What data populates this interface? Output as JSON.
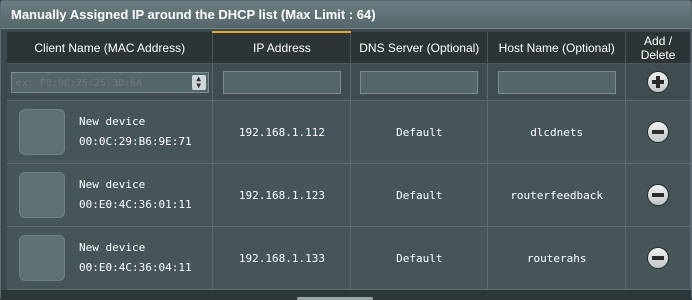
{
  "title": "Manually Assigned IP around the DHCP list (Max Limit : 64)",
  "columns": [
    "Client Name (MAC Address)",
    "IP Address",
    "DNS Server (Optional)",
    "Host Name (Optional)",
    "Add / Delete"
  ],
  "input_row": {
    "mac_placeholder": "ex: F8:0C:25:25:3D:6A",
    "ip_value": "",
    "dns_value": "",
    "host_value": "",
    "add_icon": "plus-circle-icon"
  },
  "rows": [
    {
      "name": "New device",
      "mac": "00:0C:29:B6:9E:71",
      "ip": "192.168.1.112",
      "dns": "Default",
      "host": "dlcdnets"
    },
    {
      "name": "New device",
      "mac": "00:E0:4C:36:01:11",
      "ip": "192.168.1.123",
      "dns": "Default",
      "host": "routerfeedback"
    },
    {
      "name": "New device",
      "mac": "00:E0:4C:36:04:11",
      "ip": "192.168.1.133",
      "dns": "Default",
      "host": "routerahs"
    }
  ],
  "colors": {
    "header_accent": "#e3a92a",
    "panel_bg": "#3c4a4f",
    "row_bg": "#46555a"
  }
}
